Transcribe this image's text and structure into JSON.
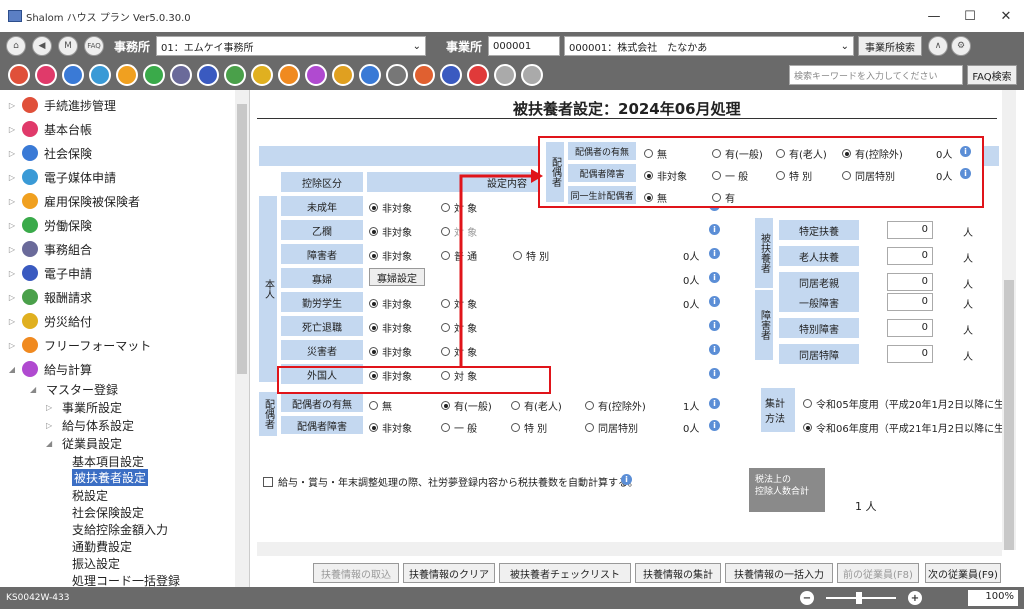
{
  "window": {
    "title": "Shalom ハウス プラン Ver5.0.30.0",
    "minimize": "—",
    "maximize": "☐",
    "close": "✕"
  },
  "toolbar1": {
    "office_label": "事務所",
    "office_value": "01：エムケイ事務所",
    "business_label": "事業所",
    "business_code": "000001",
    "business_name": "000001：株式会社　たなかあ",
    "business_search": "事業所検索",
    "faq_small": "FAQ",
    "m_icon": "M"
  },
  "toolbar2": {
    "search_placeholder": "検索キーワードを入力してください",
    "faq_button": "FAQ検索"
  },
  "sidebar": {
    "items": [
      {
        "label": "手続進捗管理",
        "color": "#e0503a"
      },
      {
        "label": "基本台帳",
        "color": "#e03a6a"
      },
      {
        "label": "社会保険",
        "color": "#3a7ad6"
      },
      {
        "label": "電子媒体申請",
        "color": "#3a9ad6"
      },
      {
        "label": "雇用保険被保険者",
        "color": "#f0a020"
      },
      {
        "label": "労働保険",
        "color": "#3aaa4a"
      },
      {
        "label": "事務組合",
        "color": "#6a6a9a"
      },
      {
        "label": "電子申請",
        "color": "#3a5ac0"
      },
      {
        "label": "報酬請求",
        "color": "#4aa04a"
      },
      {
        "label": "労災給付",
        "color": "#e0b020"
      },
      {
        "label": "フリーフォーマット",
        "color": "#f08a20"
      },
      {
        "label": "給与計算",
        "color": "#b04ad0"
      }
    ],
    "master": "マスター登録",
    "sub1": [
      "事業所設定",
      "給与体系設定",
      "従業員設定"
    ],
    "sub2": [
      "基本項目設定",
      "被扶養者設定",
      "税設定",
      "社会保険設定",
      "支給控除金額入力",
      "通勤費設定",
      "振込設定",
      "処理コード一括登録"
    ]
  },
  "main": {
    "title": "被扶養者設定：2024年06月処理",
    "kojo_kubun": "控除区分",
    "settei_naiyou": "設定内容",
    "honnin": "本人",
    "rows": [
      {
        "label": "未成年",
        "o1": "非対象",
        "o2": "対 象"
      },
      {
        "label": "乙欄",
        "o1": "非対象",
        "o2": "対 象"
      },
      {
        "label": "障害者",
        "o1": "非対象",
        "o2": "普 通",
        "o3": "特 別",
        "count": "0人"
      },
      {
        "label": "寡婦",
        "button": "寡婦設定",
        "count": "0人"
      },
      {
        "label": "勤労学生",
        "o1": "非対象",
        "o2": "対 象",
        "count": "0人"
      },
      {
        "label": "死亡退職",
        "o1": "非対象",
        "o2": "対 象"
      },
      {
        "label": "災害者",
        "o1": "非対象",
        "o2": "対 象"
      },
      {
        "label": "外国人",
        "o1": "非対象",
        "o2": "対 象"
      }
    ],
    "spouse_group": "配偶者",
    "spouse_rows": [
      {
        "label": "配偶者の有無",
        "o1": "無",
        "o2": "有(一般)",
        "o3": "有(老人)",
        "o4": "有(控除外)",
        "count": "1人"
      },
      {
        "label": "配偶者障害",
        "o1": "非対象",
        "o2": "一 般",
        "o3": "特 別",
        "o4": "同居特別",
        "count": "0人"
      }
    ],
    "dep_group": "被扶養者",
    "dep_rows": [
      {
        "label": "特定扶養",
        "value": "0",
        "unit": "人"
      },
      {
        "label": "老人扶養",
        "value": "0",
        "unit": "人"
      },
      {
        "label": "同居老親",
        "value": "0",
        "unit": "人"
      }
    ],
    "dis_group": "障害者",
    "dis_rows": [
      {
        "label": "一般障害",
        "value": "0",
        "unit": "人"
      },
      {
        "label": "特別障害",
        "value": "0",
        "unit": "人"
      },
      {
        "label": "同居特障",
        "value": "0",
        "unit": "人"
      }
    ],
    "calc_method": "集計方法",
    "calc_o1": "令和05年度用（平成20年1月2日以降に生ま",
    "calc_o2": "令和06年度用（平成21年1月2日以降に生ま",
    "auto_calc": "給与・賞与・年末調整処理の際、社労夢登録内容から税扶養数を自動計算する。",
    "tax_total_btn": "税法上の\n控除人数合計",
    "tax_total_value": "1 人"
  },
  "popup": {
    "group": "配偶者",
    "rows": [
      {
        "label": "配偶者の有無",
        "o1": "無",
        "o2": "有(一般)",
        "o3": "有(老人)",
        "o4": "有(控除外)",
        "count": "0人"
      },
      {
        "label": "配偶者障害",
        "o1": "非対象",
        "o2": "一 般",
        "o3": "特 別",
        "o4": "同居特別",
        "count": "0人"
      },
      {
        "label": "同一生計配偶者",
        "o1": "無",
        "o2": "有"
      }
    ]
  },
  "bottom_buttons": [
    "扶養情報の取込",
    "扶養情報のクリア",
    "被扶養者チェックリスト",
    "扶養情報の集計",
    "扶養情報の一括入力",
    "前の従業員(F8)",
    "次の従業員(F9)"
  ],
  "status": {
    "code": "KS0042W-433",
    "zoom": "100%",
    "minus": "−",
    "plus": "+"
  }
}
